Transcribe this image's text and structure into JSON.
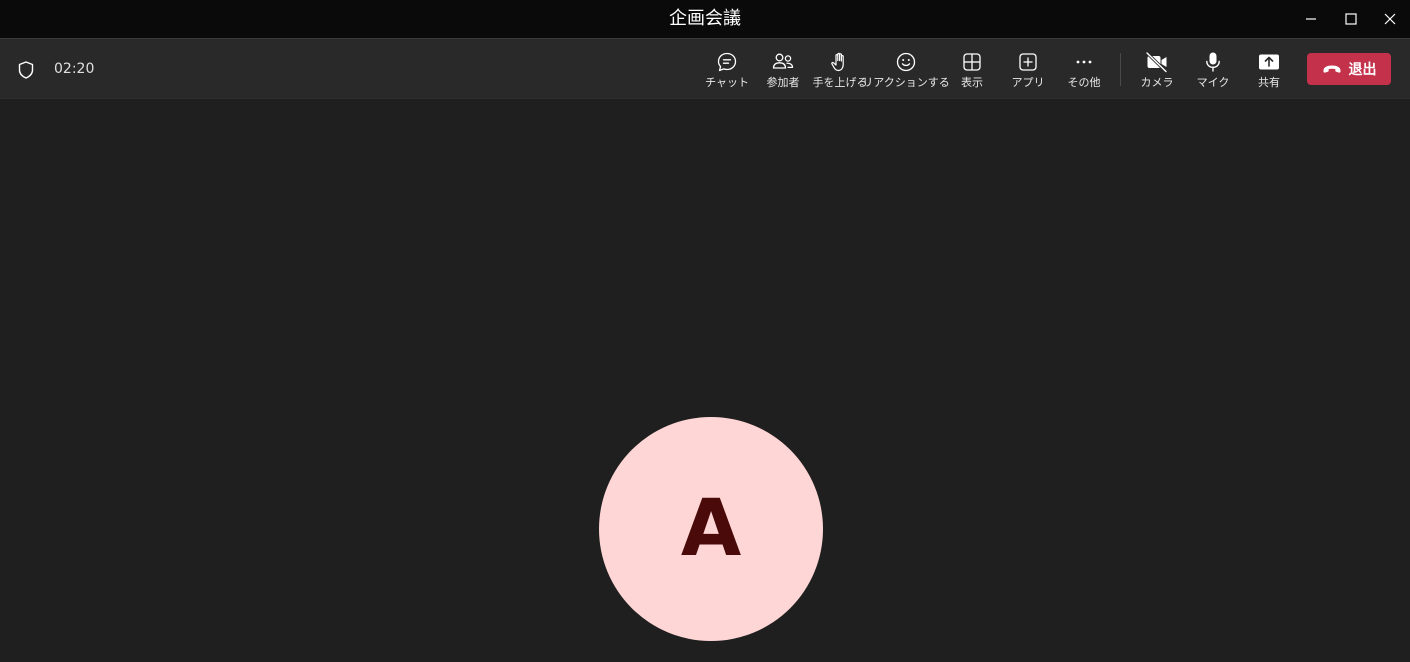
{
  "window": {
    "title": "企画会議",
    "minimize_icon": "minimize-icon",
    "maximize_icon": "maximize-icon",
    "close_icon": "close-icon"
  },
  "toolbar": {
    "timer": "02:20",
    "buttons": [
      {
        "label": "チャット",
        "icon": "chat-icon"
      },
      {
        "label": "参加者",
        "icon": "people-icon"
      },
      {
        "label": "手を上げる",
        "icon": "raise-hand-icon"
      },
      {
        "label": "リアクションする",
        "icon": "smiley-icon"
      },
      {
        "label": "表示",
        "icon": "grid-view-icon"
      },
      {
        "label": "アプリ",
        "icon": "add-app-icon"
      },
      {
        "label": "その他",
        "icon": "more-icon"
      },
      {
        "label": "カメラ",
        "icon": "camera-off-icon"
      },
      {
        "label": "マイク",
        "icon": "mic-icon"
      },
      {
        "label": "共有",
        "icon": "share-icon"
      }
    ],
    "leave": {
      "label": "退出",
      "icon": "hang-up-icon",
      "color": "#c4314b"
    }
  },
  "stage": {
    "participant_initial": "A",
    "avatar_color": "#ffd6d6",
    "initial_color": "#4a0a0a"
  }
}
